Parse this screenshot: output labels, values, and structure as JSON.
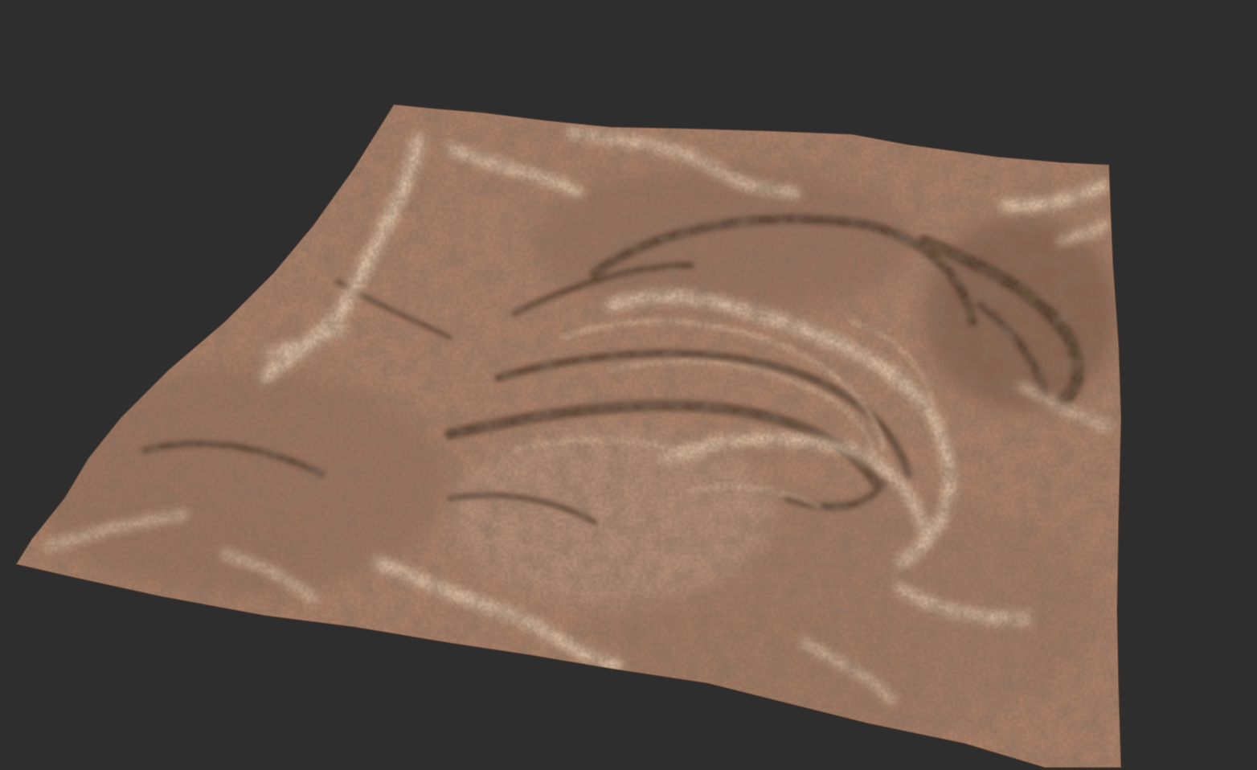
{
  "scene": {
    "background_color": "#2e2e2e",
    "subject": "terrain-heightfield-render",
    "colors": {
      "rock_base": "#a97f67",
      "rock_dark": "#6d4e3e",
      "rock_shadow": "#4a3428",
      "sand_light": "#e6cdb2",
      "sand_mid": "#cfae92",
      "ridge_highlight": "#d8b89c"
    }
  }
}
